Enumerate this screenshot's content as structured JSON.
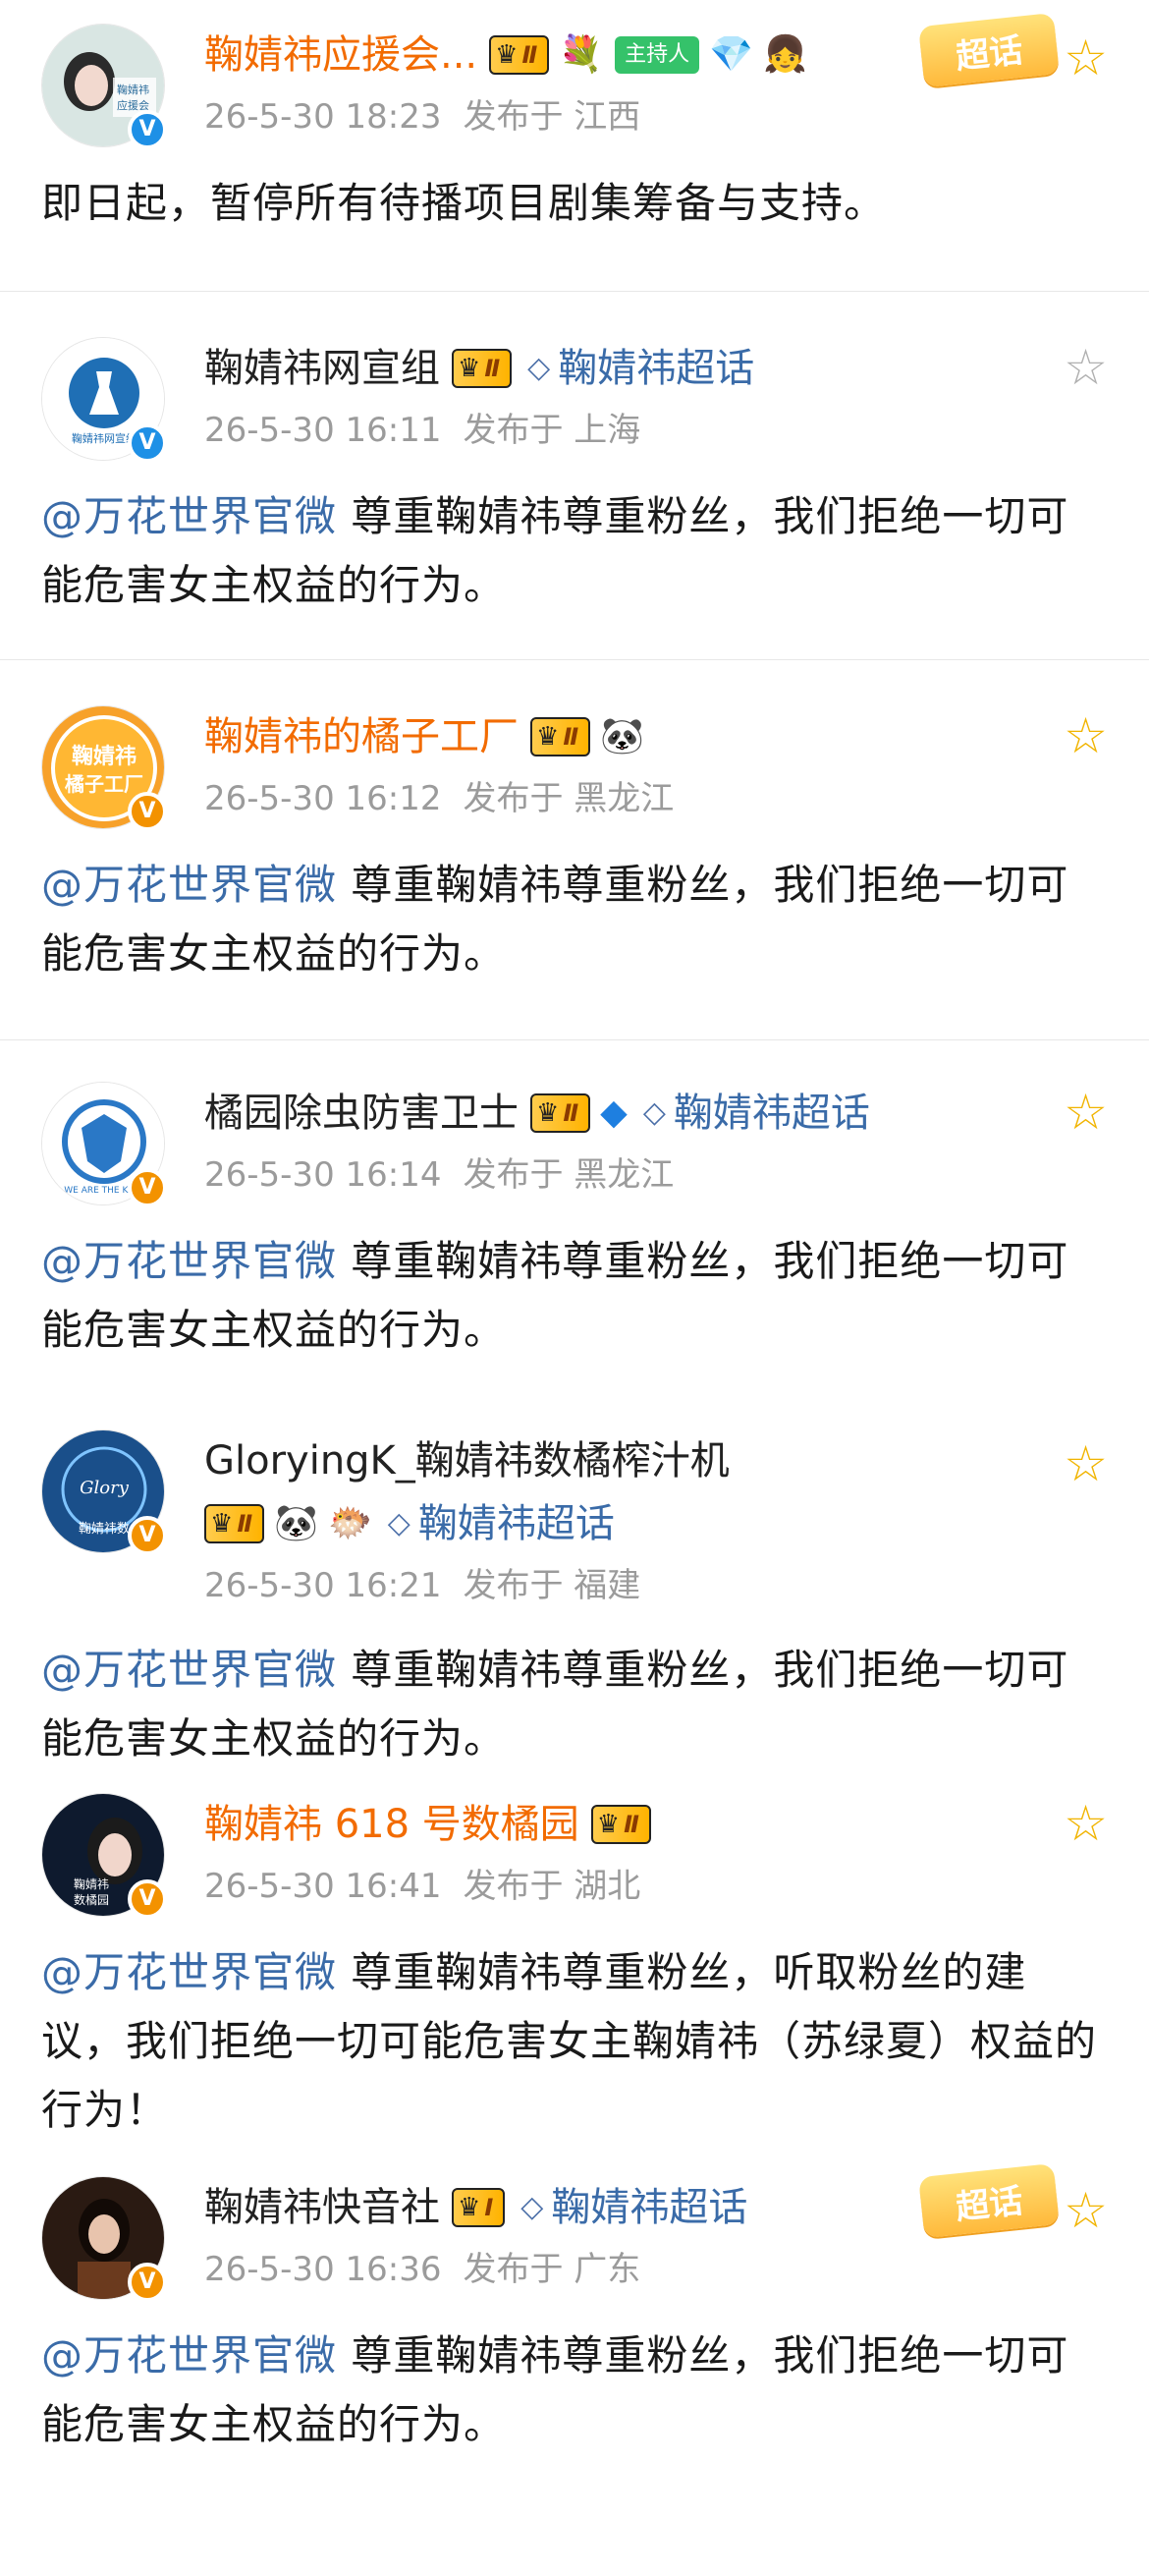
{
  "posts": [
    {
      "name": "鞠婧祎应援会...",
      "name_color": "#f26b00",
      "level": "Ⅱ",
      "host_badge": "主持人",
      "chaohua_tag": "超话",
      "time": "26-5-30 18:23",
      "location": "发布于 江西",
      "text_plain": "即日起，暂停所有待播项目剧集筹备与支持。",
      "star_state": "outline-yellow",
      "avatar_text": "鞠婧祎\n应援会"
    },
    {
      "name": "鞠婧祎网宣组",
      "level": "Ⅱ",
      "chaohua": "鞠婧祎超话",
      "time": "26-5-30 16:11",
      "location": "发布于 上海",
      "mention": "@万花世界官微",
      "text_after": " 尊重鞠婧祎尊重粉丝，我们拒绝一切可能危害女主权益的行为。",
      "star_state": "outline-gray",
      "avatar_text": "鞠婧祎\n网宣组"
    },
    {
      "name": "鞠婧祎的橘子工厂",
      "name_color": "#f26b00",
      "level": "Ⅱ",
      "emoji": "🐼",
      "time": "26-5-30 16:12",
      "location": "发布于 黑龙江",
      "mention": "@万花世界官微",
      "text_after": " 尊重鞠婧祎尊重粉丝，我们拒绝一切可能危害女主权益的行为。",
      "star_state": "outline-yellow",
      "avatar_text": "鞠婧祎\n橘子工厂"
    },
    {
      "name": "橘园除虫防害卫士",
      "level": "Ⅱ",
      "chaohua": "鞠婧祎超话",
      "time": "26-5-30 16:14",
      "location": "发布于 黑龙江",
      "mention": "@万花世界官微",
      "text_after": " 尊重鞠婧祎尊重粉丝，我们拒绝一切可能危害女主权益的行为。",
      "star_state": "outline-yellow"
    },
    {
      "name": "GloryingK_鞠婧祎数橘榨汁机",
      "level": "Ⅱ",
      "emoji": "🐼",
      "chaohua": "鞠婧祎超话",
      "time": "26-5-30 16:21",
      "location": "发布于 福建",
      "mention": "@万花世界官微",
      "text_after": " 尊重鞠婧祎尊重粉丝，我们拒绝一切可能危害女主权益的行为。",
      "star_state": "outline-yellow",
      "avatar_text": "鞠婧祎数"
    },
    {
      "name": "鞠婧祎 618 号数橘园",
      "name_color": "#f26b00",
      "level": "Ⅱ",
      "time": "26-5-30 16:41",
      "location": "发布于 湖北",
      "mention": "@万花世界官微",
      "text_after": " 尊重鞠婧祎尊重粉丝，听取粉丝的建议，我们拒绝一切可能危害女主鞠婧祎（苏绿夏）权益的行为！",
      "star_state": "outline-yellow",
      "avatar_text": "鞠婧祎\n数橘园"
    },
    {
      "name": "鞠婧祎快音社",
      "level": "Ⅰ",
      "chaohua": "鞠婧祎超话",
      "chaohua_tag": "超话",
      "time": "26-5-30 16:36",
      "location": "发布于 广东",
      "mention": "@万花世界官微",
      "text_after": " 尊重鞠婧祎尊重粉丝，我们拒绝一切可能危害女主权益的行为。",
      "star_state": "outline-yellow"
    }
  ],
  "icons": {
    "verified_v": "V",
    "crown": "♛",
    "diamond": "◇",
    "star": "☆"
  },
  "colors": {
    "orange_name": "#f26b00",
    "link_blue": "#3a6ba8",
    "meta_gray": "#9b9b9b",
    "star_yellow": "#f1b400",
    "v_blue": "#1e90e6",
    "v_orange": "#f39200"
  }
}
